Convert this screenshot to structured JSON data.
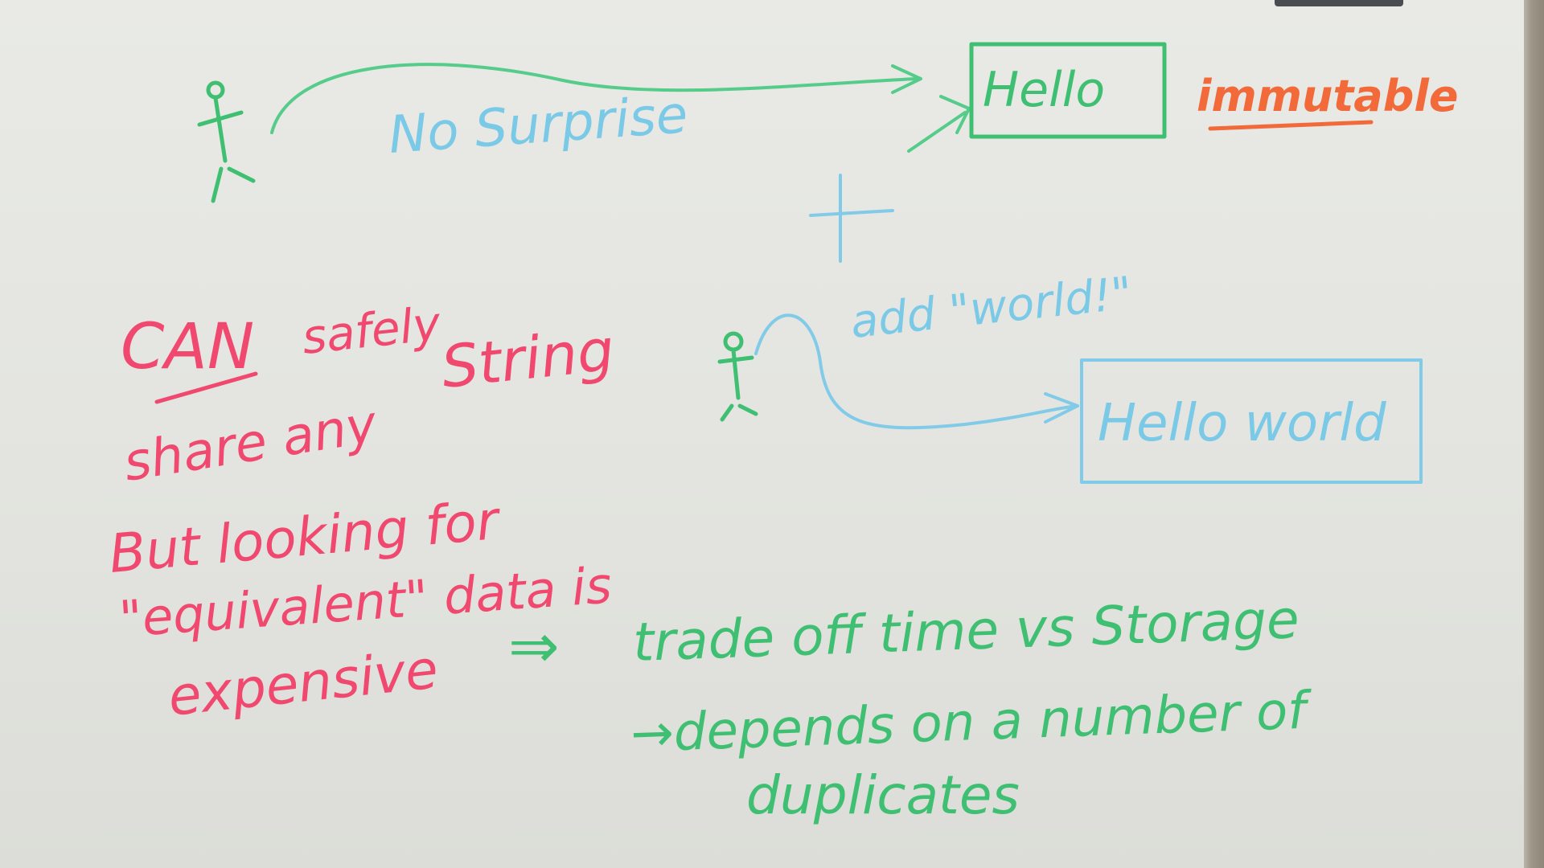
{
  "whiteboard": {
    "top": {
      "arrow_label": "No Surprise",
      "box_text": "Hello",
      "side_note": "immutable",
      "plus": "+"
    },
    "middle": {
      "action_label": "add \"world!\"",
      "box_text": "Hello world"
    },
    "left_notes": {
      "line1_a": "CAN",
      "line1_b": "safely",
      "line2_a": "share any",
      "line2_b": "String",
      "line3": "But looking for",
      "line4": "\"equivalent\" data is",
      "line5": "expensive"
    },
    "right_notes": {
      "implies": "⇒",
      "line1": "trade off time vs Storage",
      "line2": "→depends on a number of",
      "line3": "duplicates"
    }
  },
  "colors": {
    "board": "#e6e7e2",
    "green": "#3fbf72",
    "blue": "#7ac9e6",
    "pink": "#f0486e",
    "orange": "#f26a3a"
  }
}
